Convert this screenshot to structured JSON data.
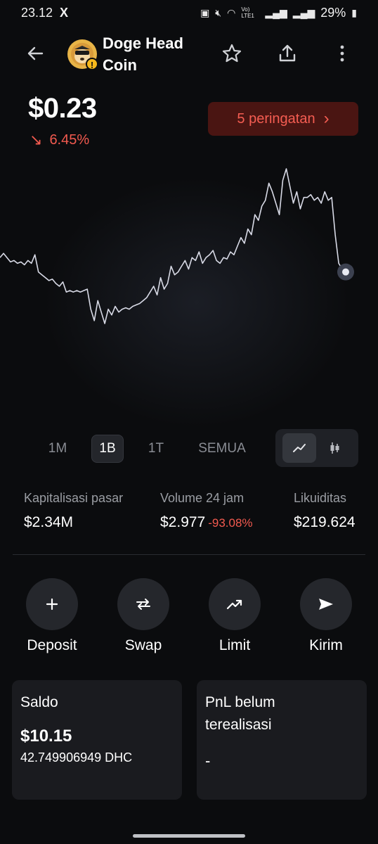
{
  "status_bar": {
    "time": "23.12",
    "x_logo": "X",
    "battery": "29%",
    "network_label": "Vo) LTE1"
  },
  "header": {
    "coin_name_line1": "Doge Head",
    "coin_name_line2": "Coin",
    "warning_mark": "!"
  },
  "price": {
    "value": "$0.23",
    "change_arrow": "↘",
    "change": "6.45%"
  },
  "warnings_button": {
    "label": "5 peringatan",
    "chevron": "›"
  },
  "chart_data": {
    "type": "line",
    "title": "",
    "xlabel": "",
    "ylabel": "",
    "x": [
      0,
      1,
      2,
      3,
      4,
      5,
      6,
      7,
      8,
      9,
      10,
      11,
      12,
      13,
      14,
      15,
      16,
      17,
      18,
      19,
      20,
      21,
      22,
      23,
      24,
      25,
      26,
      27,
      28,
      29,
      30,
      31,
      32,
      33,
      34,
      35,
      36,
      37,
      38,
      39,
      40,
      41,
      42,
      43,
      44,
      45,
      46,
      47,
      48,
      49,
      50,
      51,
      52,
      53,
      54,
      55,
      56,
      57,
      58,
      59,
      60,
      61,
      62,
      63,
      64,
      65,
      66,
      67,
      68,
      69,
      70,
      71,
      72,
      73,
      74,
      75,
      76,
      77,
      78,
      79,
      80,
      81,
      82,
      83,
      84,
      85,
      86,
      87,
      88,
      89,
      90,
      91,
      92,
      93,
      94,
      95,
      96,
      97,
      98,
      99
    ],
    "values": [
      58,
      61,
      58,
      55,
      56,
      54,
      55,
      53,
      56,
      54,
      60,
      48,
      46,
      44,
      42,
      43,
      40,
      38,
      41,
      34,
      35,
      34,
      35,
      34,
      35,
      36,
      22,
      14,
      28,
      20,
      12,
      22,
      18,
      24,
      20,
      22,
      23,
      22,
      24,
      25,
      26,
      28,
      30,
      34,
      38,
      32,
      44,
      36,
      40,
      52,
      46,
      48,
      52,
      56,
      50,
      58,
      56,
      62,
      54,
      58,
      60,
      63,
      56,
      54,
      58,
      57,
      62,
      60,
      66,
      72,
      68,
      78,
      74,
      88,
      84,
      94,
      98,
      110,
      104,
      96,
      88,
      112,
      120,
      108,
      96,
      104,
      92,
      100,
      100,
      102,
      98,
      100,
      96,
      104,
      98,
      100,
      74,
      54,
      50,
      48
    ],
    "current_marker": true,
    "grid": false,
    "color": "#d8dae6"
  },
  "ranges": {
    "items": [
      "1M",
      "1B",
      "1T",
      "SEMUA"
    ],
    "active": "1B"
  },
  "chart_type_toggle": {
    "active": "line"
  },
  "stats": {
    "market_cap_label": "Kapitalisasi pasar",
    "market_cap_value": "$2.34M",
    "volume_label": "Volume 24 jam",
    "volume_value": "$2.977",
    "volume_change": "-93.08%",
    "liquidity_label": "Likuiditas",
    "liquidity_value": "$219.624"
  },
  "actions": {
    "deposit": "Deposit",
    "swap": "Swap",
    "limit": "Limit",
    "send": "Kirim"
  },
  "balance_card": {
    "title": "Saldo",
    "usd": "$10.15",
    "token_amount": "42.749906949 DHC"
  },
  "pnl_card": {
    "title_line1": "PnL belum",
    "title_line2": "terealisasi",
    "value": "-"
  },
  "colors": {
    "negative": "#f25a4f",
    "background": "#0b0c0e",
    "card": "#1a1b1f",
    "warning_bg": "#4a1512"
  }
}
